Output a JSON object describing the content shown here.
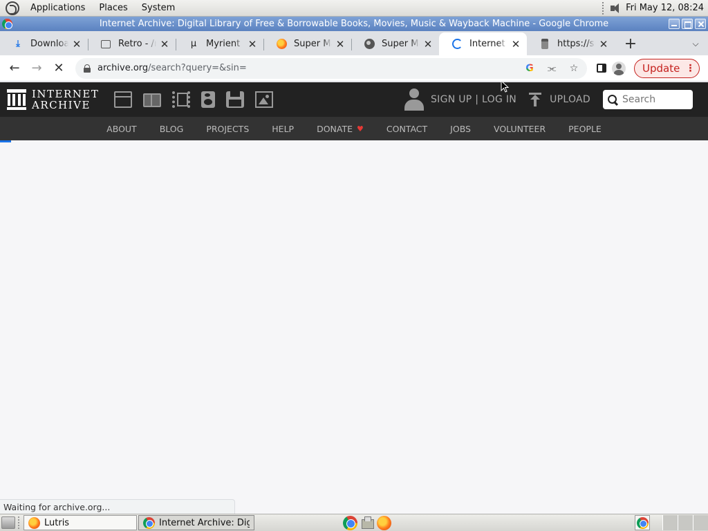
{
  "top_panel": {
    "menus": [
      "Applications",
      "Places",
      "System"
    ],
    "clock": "Fri May 12, 08:24"
  },
  "window": {
    "title": "Internet Archive: Digital Library of Free & Borrowable Books, Movies, Music & Wayback Machine - Google Chrome"
  },
  "tabs": [
    {
      "title": "Downloads",
      "icon": "download-icon",
      "active": false
    },
    {
      "title": "Retro - /r/R",
      "icon": "document-icon",
      "active": false
    },
    {
      "title": "Myrient | Ge",
      "icon": "myrient-icon",
      "active": false
    },
    {
      "title": "Super Mario",
      "icon": "firefox-icon",
      "active": false
    },
    {
      "title": "Super Mario",
      "icon": "globe-icon",
      "active": false
    },
    {
      "title": "Internet Archive",
      "icon": "loading-spinner-icon",
      "active": true
    },
    {
      "title": "https://sup",
      "icon": "bottle-icon",
      "active": false
    }
  ],
  "toolbar": {
    "url_host": "archive.org",
    "url_path": "/search?query=&sin=",
    "update_label": "Update"
  },
  "ia_header": {
    "logo_line1": "INTERNET",
    "logo_line2": "ARCHIVE",
    "signup_label": "SIGN UP | LOG IN",
    "upload_label": "UPLOAD",
    "search_placeholder": "Search"
  },
  "ia_nav": {
    "items": [
      "ABOUT",
      "BLOG",
      "PROJECTS",
      "HELP",
      "DONATE",
      "CONTACT",
      "JOBS",
      "VOLUNTEER",
      "PEOPLE"
    ]
  },
  "status": {
    "text": "Waiting for archive.org..."
  },
  "taskbar": {
    "lutris_label": "Lutris",
    "ia_label": "Internet Archive: Digi..."
  },
  "colors": {
    "ia_header_bg": "#222222",
    "ia_nav_bg": "#333333",
    "update_red": "#c5221f",
    "titlebar_blue": "#5b82c0"
  }
}
